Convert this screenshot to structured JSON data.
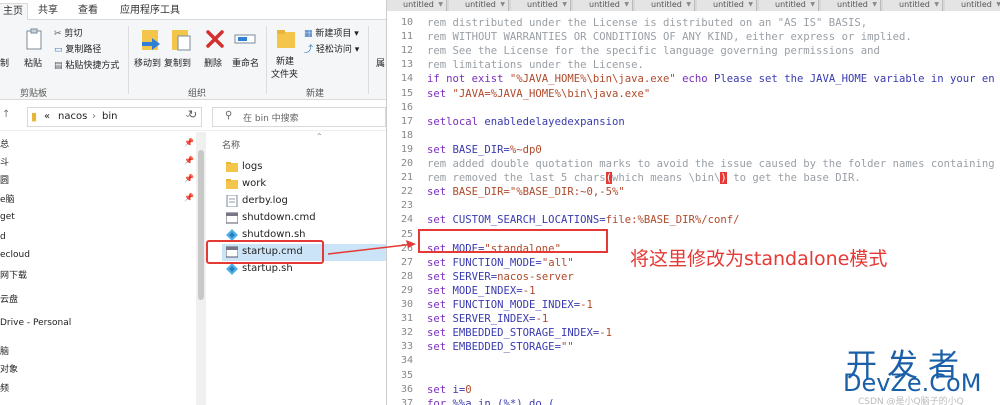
{
  "explorer": {
    "ribbon_tabs": [
      "主页",
      "共享",
      "查看",
      "应用程序工具"
    ],
    "ribbon": {
      "cut": "剪切",
      "copy_path": "复制路径",
      "paste_shortcut": "粘贴快捷方式",
      "copy_partial": "制",
      "paste": "粘贴",
      "move_to": "移动到",
      "copy_to": "复制到",
      "delete": "删除",
      "rename": "重命名",
      "new_folder_line1": "新建",
      "new_folder_line2": "文件夹",
      "new_item": "新建项目 ▾",
      "easy_access": "轻松访问 ▾",
      "properties_partial": "属",
      "group_clipboard": "剪贴板",
      "group_organize": "组织",
      "group_new": "新建"
    },
    "address": {
      "path_prefix": "«",
      "path_parent": "nacos",
      "path_sep": "›",
      "path_current": "bin",
      "search_placeholder": "在 bin 中搜索"
    },
    "column_header": "名称",
    "nav_items": [
      "总",
      "斗",
      "圆",
      "e脑",
      "get",
      "d",
      "ecloud",
      "网下载",
      "云盘",
      "Drive - Personal",
      "脑",
      "对象",
      "频"
    ],
    "files": [
      {
        "name": "logs",
        "type": "folder"
      },
      {
        "name": "work",
        "type": "folder"
      },
      {
        "name": "derby.log",
        "type": "text"
      },
      {
        "name": "shutdown.cmd",
        "type": "cmd"
      },
      {
        "name": "shutdown.sh",
        "type": "sh"
      },
      {
        "name": "startup.cmd",
        "type": "cmd"
      },
      {
        "name": "startup.sh",
        "type": "sh"
      }
    ]
  },
  "editor": {
    "tabs": [
      "untitled",
      "untitled",
      "untitled",
      "untitled",
      "untitled",
      "untitled",
      "untitled",
      "untitled",
      "untitled",
      "untitled"
    ],
    "lines": [
      {
        "n": "10",
        "parts": [
          {
            "c": "c-rem",
            "t": "rem distributed under the License is distributed on an \"AS IS\" BASIS,"
          }
        ]
      },
      {
        "n": "11",
        "parts": [
          {
            "c": "c-rem",
            "t": "rem WITHOUT WARRANTIES OR CONDITIONS OF ANY KIND, either express or implied."
          }
        ]
      },
      {
        "n": "12",
        "parts": [
          {
            "c": "c-rem",
            "t": "rem See the License for the specific language governing permissions and"
          }
        ]
      },
      {
        "n": "13",
        "parts": [
          {
            "c": "c-rem",
            "t": "rem limitations under the License."
          }
        ]
      },
      {
        "n": "14",
        "parts": [
          {
            "c": "c-kw",
            "t": "if not exist "
          },
          {
            "c": "c-str",
            "t": "\"%JAVA_HOME%\\bin\\java.exe\""
          },
          {
            "c": "c-kw",
            "t": " echo "
          },
          {
            "c": "c-var",
            "t": "Please set the JAVA_HOME variable in your en"
          }
        ]
      },
      {
        "n": "15",
        "parts": [
          {
            "c": "c-kw",
            "t": "set "
          },
          {
            "c": "c-str",
            "t": "\"JAVA=%JAVA_HOME%\\bin\\java.exe\""
          }
        ]
      },
      {
        "n": "16",
        "parts": []
      },
      {
        "n": "17",
        "parts": [
          {
            "c": "c-kw",
            "t": "setlocal "
          },
          {
            "c": "c-var",
            "t": "enabledelayedexpansion"
          }
        ]
      },
      {
        "n": "18",
        "parts": []
      },
      {
        "n": "19",
        "parts": [
          {
            "c": "c-kw",
            "t": "set "
          },
          {
            "c": "c-var",
            "t": "BASE_DIR="
          },
          {
            "c": "c-str",
            "t": "%~dp0"
          }
        ]
      },
      {
        "n": "20",
        "parts": [
          {
            "c": "c-rem",
            "t": "rem added double quotation marks to avoid the issue caused by the folder names containing"
          }
        ]
      },
      {
        "n": "21",
        "parts": [
          {
            "c": "c-rem",
            "t": "rem removed the last 5 chars"
          },
          {
            "c": "hl-paren",
            "t": "("
          },
          {
            "c": "c-rem",
            "t": "which means \\bin\\"
          },
          {
            "c": "hl-paren",
            "t": ")"
          },
          {
            "c": "c-rem",
            "t": " to get the base DIR."
          }
        ]
      },
      {
        "n": "22",
        "parts": [
          {
            "c": "c-kw",
            "t": "set "
          },
          {
            "c": "c-str",
            "t": "BASE_DIR=\"%BASE_DIR:~0,-5%\""
          }
        ]
      },
      {
        "n": "23",
        "parts": []
      },
      {
        "n": "24",
        "parts": [
          {
            "c": "c-kw",
            "t": "set "
          },
          {
            "c": "c-var",
            "t": "CUSTOM_SEARCH_LOCATIONS="
          },
          {
            "c": "c-str",
            "t": "file:%BASE_DIR%/conf/"
          }
        ]
      },
      {
        "n": "25",
        "parts": []
      },
      {
        "n": "26",
        "parts": [
          {
            "c": "c-kw",
            "t": "set "
          },
          {
            "c": "c-var",
            "t": "MODE="
          },
          {
            "c": "c-str",
            "t": "\"standalone\""
          }
        ]
      },
      {
        "n": "27",
        "parts": [
          {
            "c": "c-kw",
            "t": "set "
          },
          {
            "c": "c-var",
            "t": "FUNCTION_MODE="
          },
          {
            "c": "c-str",
            "t": "\"all\""
          }
        ]
      },
      {
        "n": "28",
        "parts": [
          {
            "c": "c-kw",
            "t": "set "
          },
          {
            "c": "c-var",
            "t": "SERVER="
          },
          {
            "c": "c-str",
            "t": "nacos-server"
          }
        ]
      },
      {
        "n": "29",
        "parts": [
          {
            "c": "c-kw",
            "t": "set "
          },
          {
            "c": "c-var",
            "t": "MODE_INDEX="
          },
          {
            "c": "c-str",
            "t": "-1"
          }
        ]
      },
      {
        "n": "30",
        "parts": [
          {
            "c": "c-kw",
            "t": "set "
          },
          {
            "c": "c-var",
            "t": "FUNCTION_MODE_INDEX="
          },
          {
            "c": "c-str",
            "t": "-1"
          }
        ]
      },
      {
        "n": "31",
        "parts": [
          {
            "c": "c-kw",
            "t": "set "
          },
          {
            "c": "c-var",
            "t": "SERVER_INDEX="
          },
          {
            "c": "c-str",
            "t": "-1"
          }
        ]
      },
      {
        "n": "32",
        "parts": [
          {
            "c": "c-kw",
            "t": "set "
          },
          {
            "c": "c-var",
            "t": "EMBEDDED_STORAGE_INDEX="
          },
          {
            "c": "c-str",
            "t": "-1"
          }
        ]
      },
      {
        "n": "33",
        "parts": [
          {
            "c": "c-kw",
            "t": "set "
          },
          {
            "c": "c-var",
            "t": "EMBEDDED_STORAGE="
          },
          {
            "c": "c-str",
            "t": "\"\""
          }
        ]
      },
      {
        "n": "34",
        "parts": []
      },
      {
        "n": "35",
        "parts": []
      },
      {
        "n": "36",
        "parts": [
          {
            "c": "c-kw",
            "t": "set "
          },
          {
            "c": "c-var",
            "t": "i="
          },
          {
            "c": "c-str",
            "t": "0"
          }
        ]
      },
      {
        "n": "37",
        "parts": [
          {
            "c": "c-kw",
            "t": "for "
          },
          {
            "c": "c-var",
            "t": "%%a in (%*) do ("
          }
        ]
      }
    ]
  },
  "annotation": "将这里修改为standalone模式",
  "watermark": {
    "top": "开发者",
    "bottom": "DevZe.CoM",
    "csdn": "CSDN @是小Q脑子的小Q"
  },
  "colors": {
    "accent_red": "#e53935",
    "watermark_blue": "#1a5fa8",
    "selection": "#cce4f7"
  }
}
